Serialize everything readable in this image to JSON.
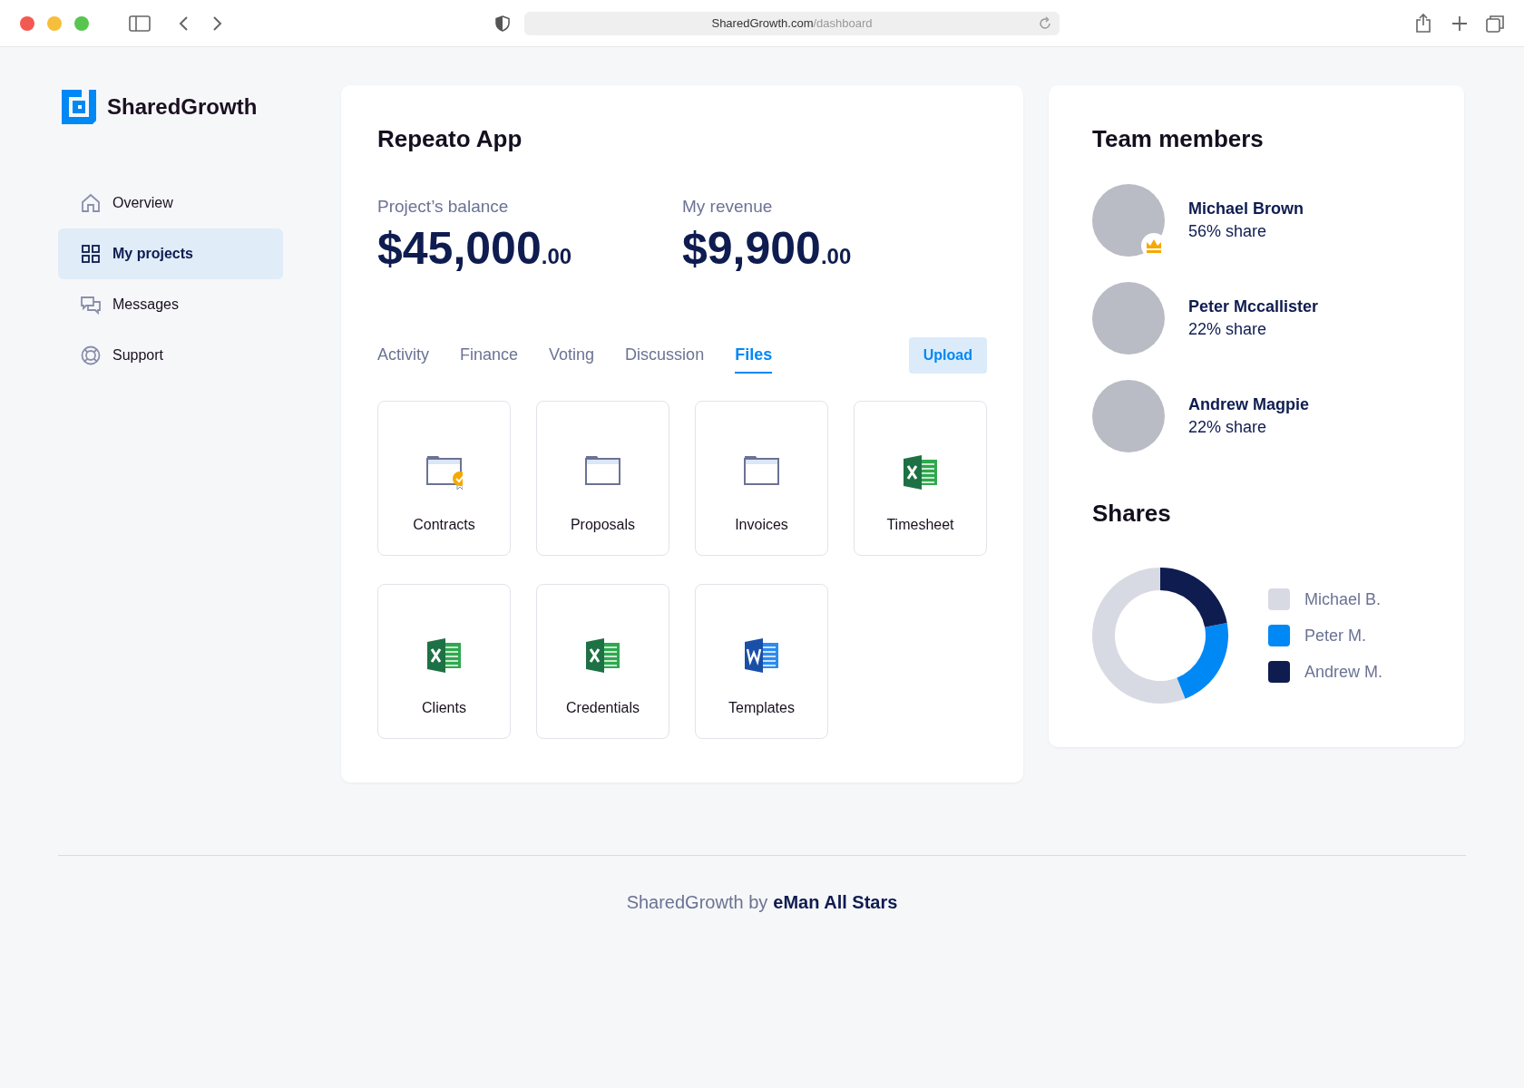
{
  "browser": {
    "url_host": "SharedGrowth.com",
    "url_path": "/dashboard"
  },
  "brand": {
    "name": "SharedGrowth"
  },
  "sidebar": {
    "items": [
      {
        "label": "Overview",
        "kind": "home",
        "selected": false
      },
      {
        "label": "My projects",
        "kind": "grid",
        "selected": true
      },
      {
        "label": "Messages",
        "kind": "chat",
        "selected": false
      },
      {
        "label": "Support",
        "kind": "lifebuoy",
        "selected": false
      }
    ]
  },
  "project": {
    "title": "Repeato App",
    "stats": [
      {
        "label": "Project’s balance",
        "amount": "$45,000",
        "cents": ".00"
      },
      {
        "label": "My revenue",
        "amount": "$9,900",
        "cents": ".00"
      }
    ],
    "tabs": [
      {
        "label": "Activity",
        "selected": false
      },
      {
        "label": "Finance",
        "selected": false
      },
      {
        "label": "Voting",
        "selected": false
      },
      {
        "label": "Discussion",
        "selected": false
      },
      {
        "label": "Files",
        "selected": true
      }
    ],
    "upload_button": "Upload",
    "files": [
      {
        "name": "Contracts",
        "kind": "certified-folder"
      },
      {
        "name": "Proposals",
        "kind": "folder"
      },
      {
        "name": "Invoices",
        "kind": "folder"
      },
      {
        "name": "Timesheet",
        "kind": "excel"
      },
      {
        "name": "Clients",
        "kind": "excel"
      },
      {
        "name": "Credentials",
        "kind": "excel"
      },
      {
        "name": "Templates",
        "kind": "word"
      }
    ]
  },
  "team": {
    "title": "Team members",
    "members": [
      {
        "name": "Michael Brown",
        "share": "56% share",
        "owner": true
      },
      {
        "name": "Peter Mccallister",
        "share": "22% share",
        "owner": false
      },
      {
        "name": "Andrew Magpie",
        "share": "22% share",
        "owner": false
      }
    ]
  },
  "shares": {
    "title": "Shares",
    "chart_data": {
      "type": "donut",
      "categories": [
        "Michael B.",
        "Peter M.",
        "Andrew M."
      ],
      "values": [
        56,
        22,
        22
      ],
      "colors": [
        "#d8dae3",
        "#0088f5",
        "#0f1c50"
      ]
    }
  },
  "footer": {
    "text": "SharedGrowth by",
    "strong": "eMan All Stars"
  }
}
